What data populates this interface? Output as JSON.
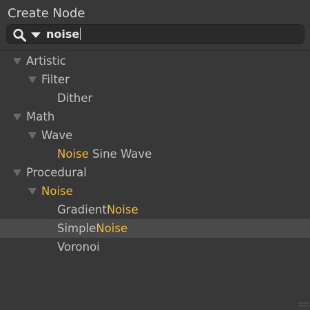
{
  "window": {
    "title": "Create Node"
  },
  "search": {
    "value": "noise",
    "icon": "search-icon",
    "dropdown_icon": "chevron-down-icon"
  },
  "colors": {
    "background": "#383838",
    "search_field": "#2a2a2a",
    "highlight": "#f1b93d",
    "text": "#c2c2c2",
    "selected_row": "#4a4a4a"
  },
  "tree": {
    "artistic": {
      "label": "Artistic"
    },
    "filter": {
      "label": "Filter"
    },
    "dither": {
      "label": "Dither"
    },
    "math": {
      "label": "Math"
    },
    "wave": {
      "label": "Wave"
    },
    "noise_sine_wave": {
      "match": "Noise",
      "rest": " Sine Wave"
    },
    "procedural": {
      "label": "Procedural"
    },
    "noise_folder": {
      "label": "Noise"
    },
    "gradient_noise": {
      "prefix": "Gradient",
      "match": "Noise"
    },
    "simple_noise": {
      "prefix": "Simple",
      "match": "Noise"
    },
    "voronoi": {
      "label": "Voronoi"
    }
  },
  "selected_item": "SimpleNoise"
}
